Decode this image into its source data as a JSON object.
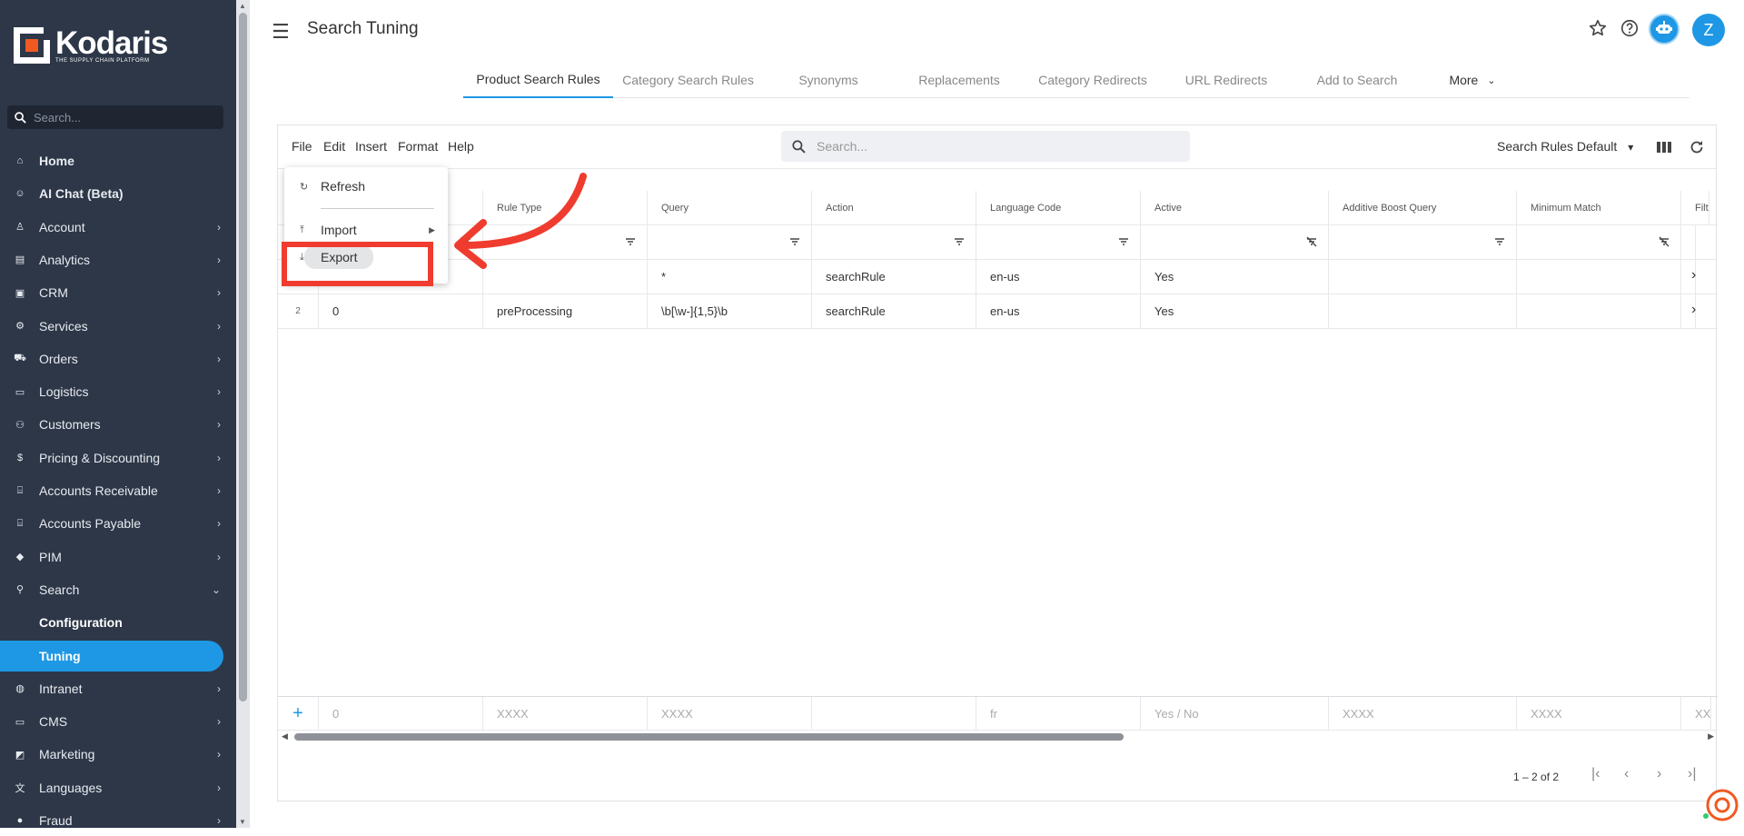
{
  "brand": {
    "name": "Kodaris",
    "tagline": "THE SUPPLY CHAIN PLATFORM",
    "accent": "#1e98e4",
    "sidebar_bg": "#2d3748"
  },
  "sidebar": {
    "search_placeholder": "Search...",
    "items": [
      {
        "label": "Home",
        "icon": "home-icon",
        "chevron": false
      },
      {
        "label": "AI Chat (Beta)",
        "icon": "robot-icon",
        "chevron": false
      },
      {
        "label": "Account",
        "icon": "person-icon",
        "chevron": true
      },
      {
        "label": "Analytics",
        "icon": "chart-icon",
        "chevron": true
      },
      {
        "label": "CRM",
        "icon": "contact-card-icon",
        "chevron": true
      },
      {
        "label": "Services",
        "icon": "gears-icon",
        "chevron": true
      },
      {
        "label": "Orders",
        "icon": "truck-icon",
        "chevron": true
      },
      {
        "label": "Logistics",
        "icon": "shipping-icon",
        "chevron": true
      },
      {
        "label": "Customers",
        "icon": "people-icon",
        "chevron": true
      },
      {
        "label": "Pricing & Discounting",
        "icon": "dollar-icon",
        "chevron": true
      },
      {
        "label": "Accounts Receivable",
        "icon": "bank-icon",
        "chevron": true
      },
      {
        "label": "Accounts Payable",
        "icon": "bank-icon",
        "chevron": true
      },
      {
        "label": "PIM",
        "icon": "tag-icon",
        "chevron": true
      },
      {
        "label": "Search",
        "icon": "search-icon",
        "chevron": true,
        "expanded": true
      },
      {
        "label": "Intranet",
        "icon": "globe-icon",
        "chevron": true
      },
      {
        "label": "CMS",
        "icon": "browser-icon",
        "chevron": true
      },
      {
        "label": "Marketing",
        "icon": "megaphone-icon",
        "chevron": true
      },
      {
        "label": "Languages",
        "icon": "translate-icon",
        "chevron": true
      },
      {
        "label": "Fraud",
        "icon": "alert-icon",
        "chevron": true
      }
    ],
    "sub_items": [
      {
        "label": "Configuration",
        "active": false
      },
      {
        "label": "Tuning",
        "active": true
      }
    ]
  },
  "header": {
    "title": "Search Tuning",
    "avatar_letter": "Z",
    "tabs": [
      {
        "label": "Product Search Rules",
        "active": true
      },
      {
        "label": "Category Search Rules"
      },
      {
        "label": "Synonyms"
      },
      {
        "label": "Replacements"
      },
      {
        "label": "Category Redirects"
      },
      {
        "label": "URL Redirects"
      },
      {
        "label": "Add to Search"
      },
      {
        "label": "More"
      }
    ]
  },
  "toolbar": {
    "menus": [
      "File",
      "Edit",
      "Insert",
      "Format",
      "Help"
    ],
    "search_placeholder": "Search...",
    "view_select": "Search Rules Default"
  },
  "file_menu": {
    "items": [
      {
        "label": "Refresh",
        "icon": "refresh-icon"
      },
      {
        "label": "Import",
        "icon": "upload-icon",
        "submenu": true
      },
      {
        "label": "Export",
        "icon": "download-icon",
        "highlighted": true
      }
    ]
  },
  "grid": {
    "columns": [
      "",
      "Rule Type",
      "Query",
      "Action",
      "Language Code",
      "Active",
      "Additive Boost Query",
      "Minimum Match",
      "Filt"
    ],
    "rows": [
      {
        "num": "",
        "cells": [
          "",
          "",
          "*",
          "searchRule",
          "en-us",
          "Yes",
          "",
          "",
          ""
        ]
      },
      {
        "num": "2",
        "cells": [
          "0",
          "preProcessing",
          "\\b[\\w-]{1,5}\\b",
          "searchRule",
          "en-us",
          "Yes",
          "",
          "",
          ""
        ]
      }
    ],
    "new_row_placeholders": [
      "0",
      "XXXX",
      "XXXX",
      "",
      "fr",
      "Yes / No",
      "XXXX",
      "XXXX",
      "XX"
    ],
    "pagination": "1 – 2 of 2"
  }
}
